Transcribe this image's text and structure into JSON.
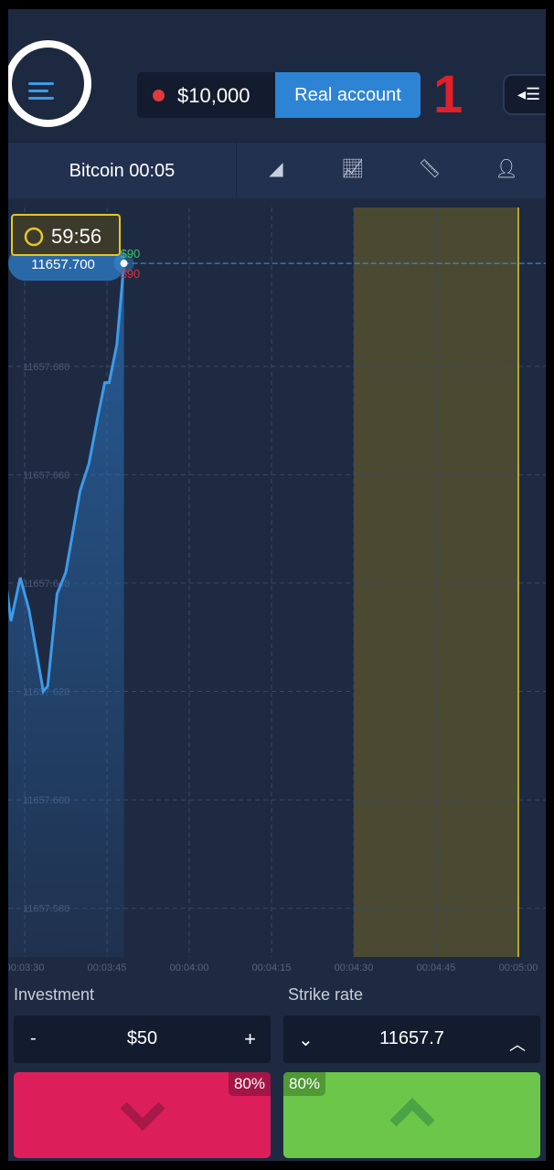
{
  "header": {
    "balance": "$10,000",
    "account_type": "Real account",
    "annotation": "1"
  },
  "toolbar": {
    "asset": "Bitcoin 00:05",
    "tools": [
      "area-chart-icon",
      "indicators-icon",
      "ruler-icon",
      "add-friend-icon"
    ]
  },
  "chart_data": {
    "type": "area",
    "timer": "59:56",
    "current_price": "11657.700",
    "payout_up": "$90",
    "payout_down": "$90",
    "y_ticks": [
      "11657.680",
      "11657.660",
      "11657.640",
      "11657.620",
      "11657.600",
      "11657.580"
    ],
    "x_ticks": [
      "00:03:30",
      "00:03:45",
      "00:04:00",
      "00:04:15",
      "00:04:30",
      "00:04:45",
      "00:05:00"
    ],
    "ylim": [
      11657.571,
      11657.711
    ],
    "xlim": [
      "00:03:27",
      "00:05:05"
    ],
    "expiry_window": [
      "00:04:30",
      "00:05:00"
    ],
    "x": [
      "00:03:26.6",
      "00:03:27.5",
      "00:03:29.2",
      "00:03:30.8",
      "00:03:33.4",
      "00:03:34.2",
      "00:03:35.9",
      "00:03:37.5",
      "00:03:40.1",
      "00:03:41.7",
      "00:03:43.4",
      "00:03:44.6",
      "00:03:45.4",
      "00:03:46.8",
      "00:03:48.1"
    ],
    "values": [
      11657.64,
      11657.633,
      11657.641,
      11657.635,
      11657.62,
      11657.621,
      11657.638,
      11657.642,
      11657.657,
      11657.662,
      11657.671,
      11657.677,
      11657.677,
      11657.684,
      11657.699
    ],
    "colors": {
      "line": "#3d9be9",
      "expiry": "#4a4a33",
      "expiry_line": "#e6c629"
    }
  },
  "controls": {
    "investment_label": "Investment",
    "investment_value": "$50",
    "minus": "-",
    "plus": "+",
    "strike_label": "Strike rate",
    "strike_value": "11657.7"
  },
  "trade": {
    "down_payout": "80%",
    "up_payout": "80%",
    "down_color": "#dc1f5b",
    "up_color": "#6cc64a"
  }
}
